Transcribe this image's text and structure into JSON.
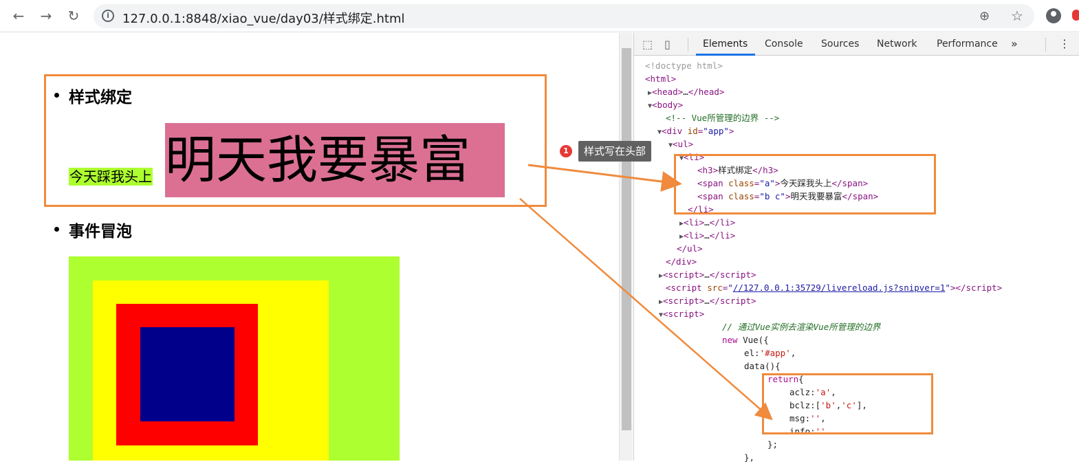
{
  "browser": {
    "url": "127.0.0.1:8848/xiao_vue/day03/样式绑定.html",
    "back_icon": "arrow-left-icon",
    "forward_icon": "arrow-right-icon",
    "reload_icon": "reload-icon"
  },
  "page": {
    "items": [
      {
        "heading": "样式绑定",
        "span_a": "今天踩我头上",
        "span_bc": "明天我要暴富"
      },
      {
        "heading": "事件冒泡"
      }
    ],
    "colors": {
      "span_a_bg": "#adff2f",
      "span_bc_bg": "#db7093",
      "outer": "#adff2f",
      "yellow": "#ffff00",
      "red": "#ff0000",
      "inner": "#00008b"
    }
  },
  "devtools": {
    "tabs": [
      "Elements",
      "Console",
      "Sources",
      "Network",
      "Performance"
    ],
    "more": "»",
    "menu": "⋮"
  },
  "annotation": {
    "badge": "1",
    "tooltip": "样式写在头部",
    "accent": "#f08a3c"
  }
}
